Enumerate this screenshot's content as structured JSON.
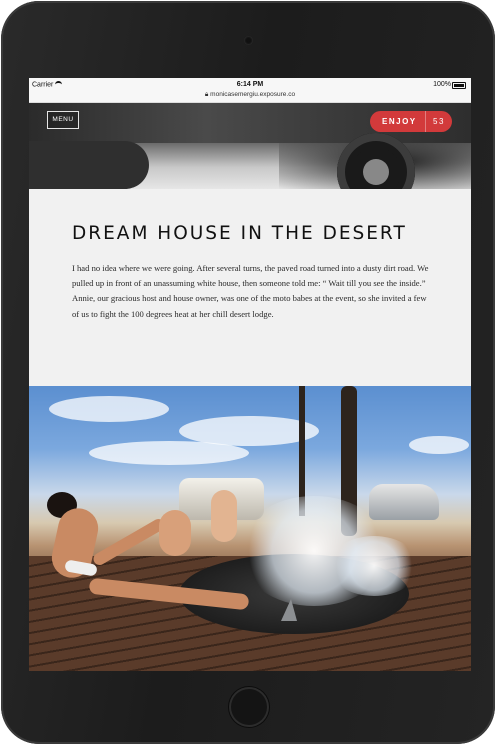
{
  "status_bar": {
    "carrier": "Carrier",
    "time": "6:14 PM",
    "battery": "100%",
    "url": "monicasemergiu.exposure.co"
  },
  "header": {
    "menu_label": "MENU",
    "enjoy_label": "ENJOY",
    "enjoy_count": "53",
    "accent_color": "#d23a3b"
  },
  "article": {
    "title": "DREAM HOUSE IN THE DESERT",
    "body": "I had no idea where we were going. After several turns, the paved road turned into a dusty dirt road. We pulled up in front of an unassuming white house, then someone told me: “ Wait till you see the inside.” Annie, our gracious host and house owner, was one of the moto babes at the event, so she invited a few of us to fight the 100 degrees heat at her chill desert lodge."
  },
  "icons": {
    "wifi": "wifi-icon",
    "battery": "battery-icon",
    "lock": "lock-icon"
  }
}
